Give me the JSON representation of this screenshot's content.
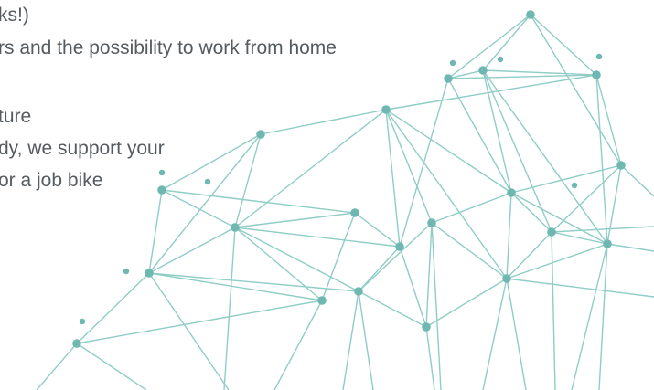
{
  "benefits": {
    "lines": [
      "ks!)",
      "rs and the possibility to work from home",
      "ture",
      "dy, we support your",
      "or a job bike"
    ]
  },
  "decoration": {
    "name": "network-graphic",
    "accent_color": "#8fcdc6",
    "node_color": "#6fb8b1"
  }
}
